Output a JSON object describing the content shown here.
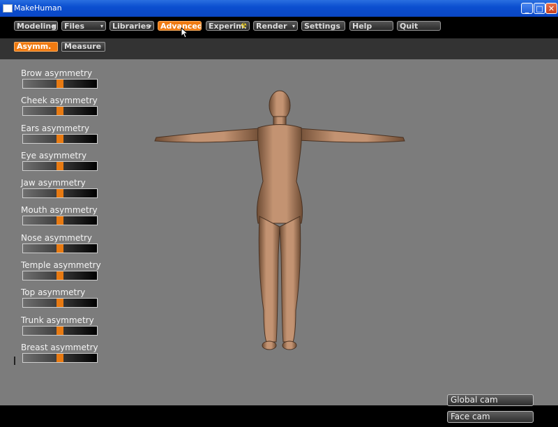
{
  "window": {
    "title": "MakeHuman",
    "minimize": "_",
    "maximize": "□",
    "close": "✕"
  },
  "menu": [
    {
      "label": "Modeling",
      "arrow": "▾",
      "active": false
    },
    {
      "label": "Files",
      "arrow": "▾",
      "active": false
    },
    {
      "label": "Libraries",
      "arrow": "▾",
      "active": false
    },
    {
      "label": "Advanced",
      "arrow": "",
      "active": true
    },
    {
      "label": "Experim.",
      "arrow": "☢",
      "active": false
    },
    {
      "label": "Render",
      "arrow": "▾",
      "active": false
    },
    {
      "label": "Settings",
      "arrow": "",
      "active": false
    },
    {
      "label": "Help",
      "arrow": "",
      "active": false
    },
    {
      "label": "Quit",
      "arrow": "",
      "active": false
    }
  ],
  "subtabs": [
    {
      "label": "Asymm.",
      "active": true
    },
    {
      "label": "Measure",
      "active": false
    }
  ],
  "sliders": [
    {
      "label": "Brow asymmetry",
      "value": 0.5
    },
    {
      "label": "Cheek asymmetry",
      "value": 0.5
    },
    {
      "label": "Ears asymmetry",
      "value": 0.5
    },
    {
      "label": "Eye asymmetry",
      "value": 0.5
    },
    {
      "label": "Jaw asymmetry",
      "value": 0.5
    },
    {
      "label": "Mouth asymmetry",
      "value": 0.5
    },
    {
      "label": "Nose asymmetry",
      "value": 0.5
    },
    {
      "label": "Temple asymmetry",
      "value": 0.5
    },
    {
      "label": "Top asymmetry",
      "value": 0.5
    },
    {
      "label": "Trunk asymmetry",
      "value": 0.5
    },
    {
      "label": "Breast asymmetry",
      "value": 0.5
    }
  ],
  "camera": {
    "global": "Global cam",
    "face": "Face cam"
  },
  "colors": {
    "accent": "#f07b12",
    "viewport": "#7c7c7c",
    "skin": "#b88a66"
  }
}
